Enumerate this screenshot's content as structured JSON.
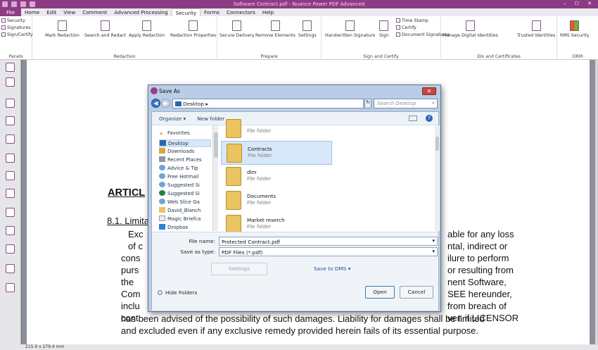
{
  "window": {
    "title": "Software Contract.pdf - Nuance Power PDF Advanced",
    "controls": "– ☐ ✕"
  },
  "menu": [
    "File",
    "Home",
    "Edit",
    "View",
    "Comment",
    "Advanced Processing",
    "Security",
    "Forms",
    "Connectors",
    "Help"
  ],
  "ribbon": {
    "panels": {
      "items": [
        "Security",
        "Signatures",
        "Sign/Certify"
      ],
      "caption": "Panels"
    },
    "redaction": {
      "buttons": [
        "Mark Redaction",
        "Search and Redact",
        "Apply Redaction",
        "Redaction Properties"
      ],
      "caption": "Redaction"
    },
    "prepare": {
      "buttons": [
        "Secure Delivery",
        "Remove Elements",
        "Settings"
      ],
      "caption": "Prepare"
    },
    "sign": {
      "buttons": [
        "Handwritten Signature",
        "Sign"
      ],
      "small": [
        "Time Stamp",
        "Certify",
        "Document Signatures"
      ],
      "caption": "Sign and Certify"
    },
    "ids": {
      "buttons": [
        "Manage Digital Identities",
        "Trusted Identities"
      ],
      "caption": "IDs and Certificates"
    },
    "drm": {
      "buttons": [
        "RMS Security"
      ],
      "caption": "DRM"
    }
  },
  "document": {
    "heading": "ARTICL",
    "subheading": "8.1. Limita",
    "left_lines": [
      "Exc",
      "of c",
      "cons",
      "purs",
      "the",
      "Com",
      "inclu",
      "cont"
    ],
    "right_lines": [
      "able for any loss",
      "ntal, indirect or",
      "ilure to perform",
      "or resulting from",
      "nent Software,",
      "SEE hereunder,",
      "from breach of",
      "ven if LICENSOR"
    ],
    "full_lines": [
      "has been advised of the possibility of such damages. Liability for damages shall be limited",
      "and excluded even if any exclusive remedy provided herein fails of its essential purpose."
    ]
  },
  "status": {
    "page_size": "215.9 x 279.4 mm"
  },
  "dialog": {
    "title": "Save As",
    "close": "✕",
    "breadcrumb": "Desktop ▸",
    "search_placeholder": "Search Desktop",
    "toolbar": {
      "organize": "Organize ▾",
      "new_folder": "New folder"
    },
    "nav": [
      "Favorites",
      "Desktop",
      "Downloads",
      "Recent Places",
      "Advice & Tip",
      "Free Hotmail",
      "Suggested Si",
      "Suggested Si",
      "Web Slice Ga",
      "David_Blanch",
      "Magic Briefca",
      "Dropbox"
    ],
    "files": [
      {
        "name": "",
        "type": "File folder"
      },
      {
        "name": "Contracts",
        "type": "File folder"
      },
      {
        "name": "dlm",
        "type": "File folder"
      },
      {
        "name": "Documents",
        "type": "File folder"
      },
      {
        "name": "Market reserch",
        "type": "File folder"
      }
    ],
    "file_name_label": "File name:",
    "file_name_value": "Protected Contract.pdf",
    "save_type_label": "Save as type:",
    "save_type_value": "PDF Files (*.pdf)",
    "settings": "Settings",
    "save_to_dms": "Save to DMS ▾",
    "hide_folders": "Hide Folders",
    "open": "Open",
    "cancel": "Cancel"
  },
  "colors": {
    "accent": "#8e3b86",
    "dialog_frame": "#b9cde6",
    "selection": "#d9e8f9"
  }
}
